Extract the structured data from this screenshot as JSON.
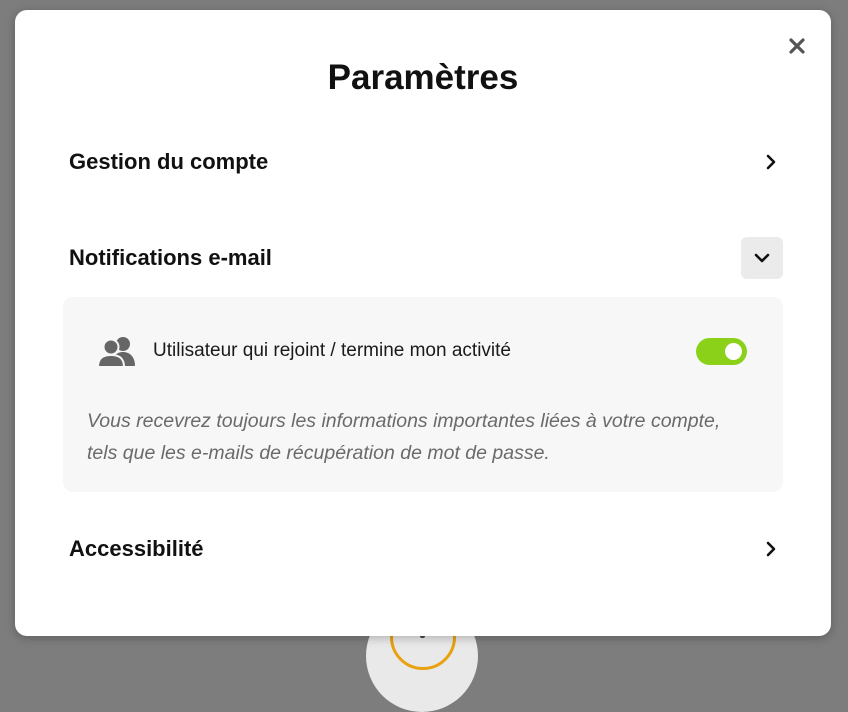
{
  "dialog": {
    "title": "Paramètres"
  },
  "sections": {
    "account": {
      "label": "Gestion du compte",
      "icon": "chevron-right-icon"
    },
    "email_notifications": {
      "label": "Notifications e-mail",
      "icon": "chevron-down-icon",
      "expanded": true,
      "settings": [
        {
          "icon": "users-icon",
          "label": "Utilisateur qui rejoint / termine mon activité",
          "enabled": true
        }
      ],
      "note": "Vous recevrez toujours les informations importantes liées à votre compte, tels que les e-mails de récupération de mot de passe."
    },
    "accessibility": {
      "label": "Accessibilité",
      "icon": "chevron-right-icon"
    }
  },
  "colors": {
    "toggle_on": "#8bd11a",
    "panel_bg": "#f7f7f7",
    "backdrop": "#7d7d7d",
    "fab_ring": "#e8a20f"
  }
}
